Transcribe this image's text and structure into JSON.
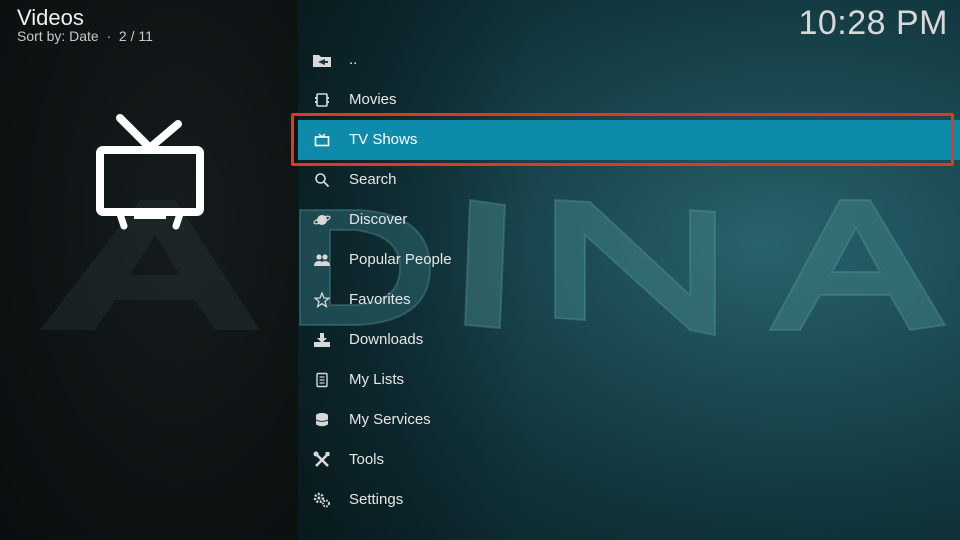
{
  "header": {
    "title": "Videos",
    "subtitle": "Sort by: Date  ·  2 / 11",
    "clock": "10:28 PM"
  },
  "watermark_text": "ADINA",
  "colors": {
    "selected_bg": "#0e8bab",
    "highlight_outline": "#e4371e",
    "panel_bg": "#123940"
  },
  "menu": {
    "items": [
      {
        "label": "..",
        "icon": "folder-back-icon"
      },
      {
        "label": "Movies",
        "icon": "film-icon"
      },
      {
        "label": "TV Shows",
        "icon": "tv-icon",
        "selected": true
      },
      {
        "label": "Search",
        "icon": "search-icon"
      },
      {
        "label": "Discover",
        "icon": "planet-icon"
      },
      {
        "label": "Popular People",
        "icon": "people-icon"
      },
      {
        "label": "Favorites",
        "icon": "star-icon"
      },
      {
        "label": "Downloads",
        "icon": "download-icon"
      },
      {
        "label": "My Lists",
        "icon": "list-icon"
      },
      {
        "label": "My Services",
        "icon": "database-icon"
      },
      {
        "label": "Tools",
        "icon": "tools-icon"
      },
      {
        "label": "Settings",
        "icon": "gear-icon"
      }
    ]
  }
}
